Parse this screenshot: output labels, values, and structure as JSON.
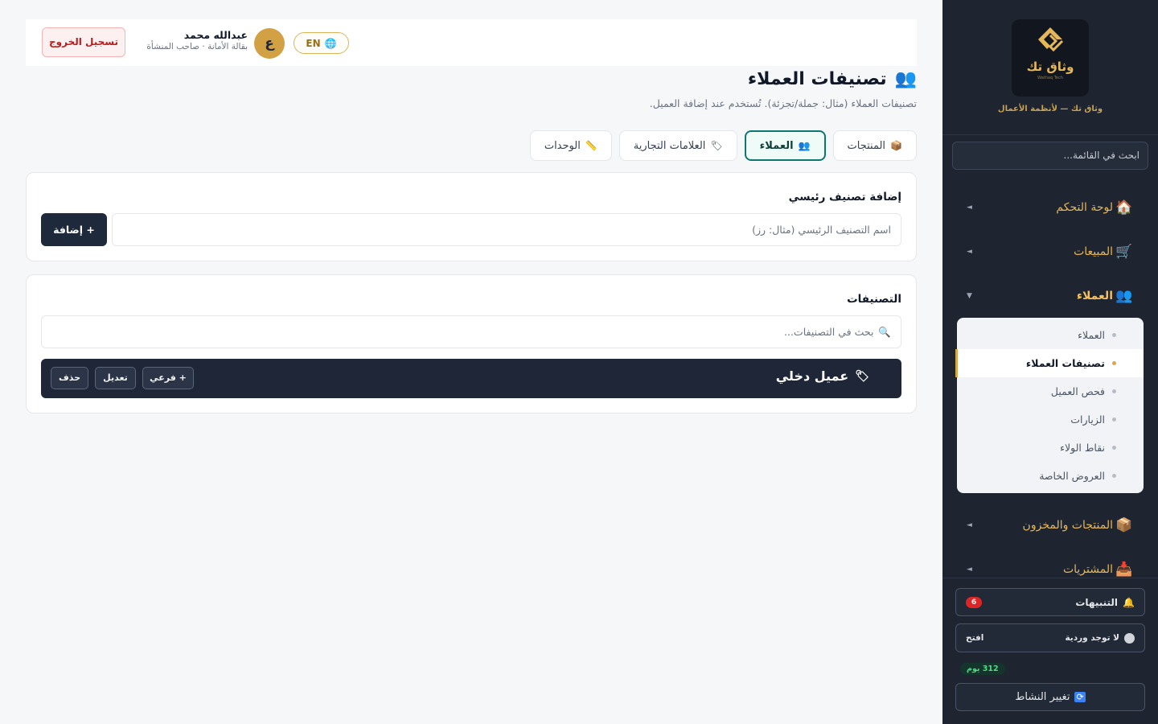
{
  "topbar": {
    "logout_label": "تسجيل الخروج",
    "user_name": "عبدالله محمد",
    "user_role": "بقالة الأمانة · صاحب المنشأة",
    "avatar_letter": "ع",
    "lang_label": "EN"
  },
  "page": {
    "title": "تصنيفات العملاء",
    "subtitle": "تصنيفات العملاء (مثال: جملة/تجزئة). تُستخدم عند إضافة العميل."
  },
  "tabs": [
    {
      "label": "المنتجات",
      "icon": "📦"
    },
    {
      "label": "العملاء",
      "icon": "👥"
    },
    {
      "label": "العلامات التجارية",
      "icon": "🏷"
    },
    {
      "label": "الوحدات",
      "icon": "📏"
    }
  ],
  "add_card": {
    "title": "إضافة تصنيف رئيسي",
    "input_placeholder": "اسم التصنيف الرئيسي (مثال: رز)",
    "add_label": "+ إضافة"
  },
  "categories_card": {
    "title": "التصنيفات",
    "search_placeholder": "بحث في التصنيفات...",
    "rows": [
      {
        "name": "عميل دخلي",
        "sub_label": "+ فرعي",
        "edit_label": "تعديل",
        "delete_label": "حذف"
      }
    ]
  },
  "sidebar": {
    "logo_text": "وثاق تك",
    "logo_subtext": "Wathaq Tech",
    "tagline": "وثاق تك — لأنظمة الأعمال",
    "search_placeholder": "ابحث في القائمة...",
    "items": [
      {
        "label": "لوحة التحكم",
        "icon": "🏠"
      },
      {
        "label": "المبيعات",
        "icon": "🛒"
      },
      {
        "label": "العملاء",
        "icon": "👥"
      },
      {
        "label": "المنتجات والمخزون",
        "icon": "📦"
      },
      {
        "label": "المشتريات",
        "icon": "📥"
      }
    ],
    "submenu": [
      {
        "label": "العملاء"
      },
      {
        "label": "تصنيفات العملاء"
      },
      {
        "label": "فحص العميل"
      },
      {
        "label": "الزيارات"
      },
      {
        "label": "نقاط الولاء"
      },
      {
        "label": "العروض الخاصة"
      }
    ],
    "notifications_label": "التنبيهات",
    "notifications_count": "6",
    "shift_label": "لا توجد وردية",
    "shift_open_label": "افتح",
    "days_left": "312 يوم",
    "switch_label": "تغيير النشاط"
  },
  "colors": {
    "sidebar_bg": "#1e2430",
    "accent_gold": "#e4b75a",
    "active_tab": "#0f766e",
    "danger": "#dc2626"
  }
}
